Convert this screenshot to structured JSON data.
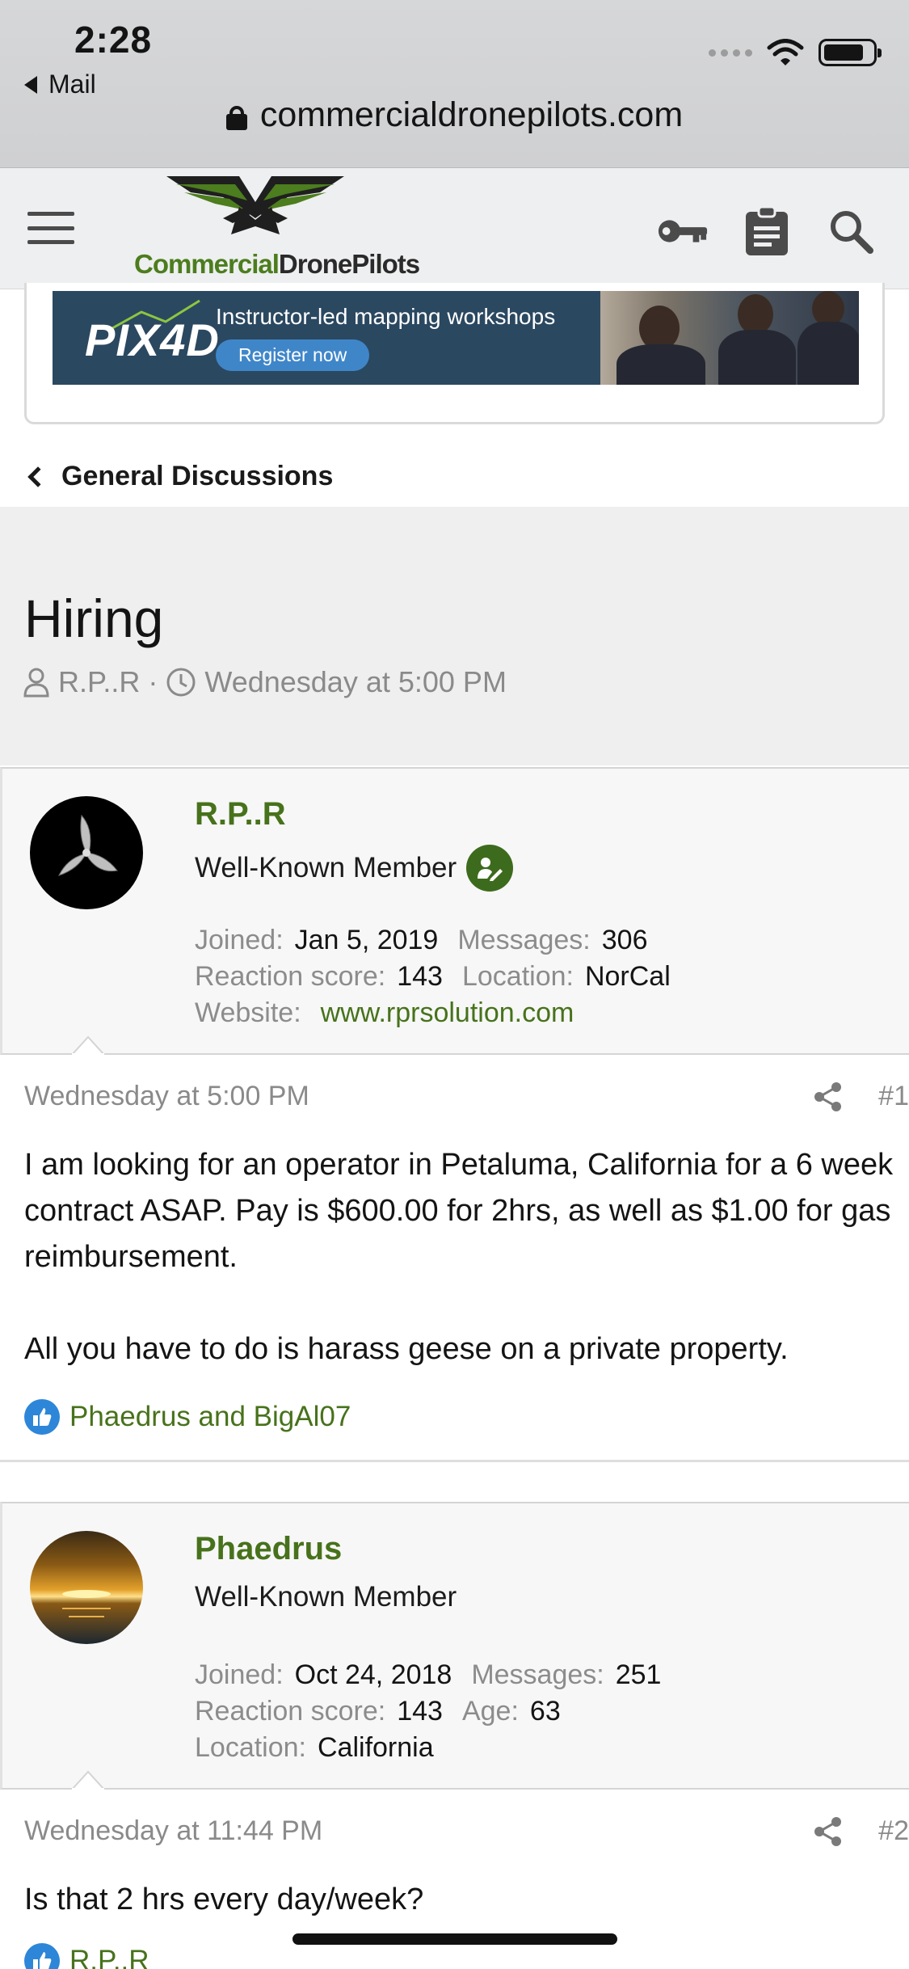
{
  "status_bar": {
    "time": "2:28",
    "back_app": "Mail"
  },
  "browser": {
    "url": "commercialdronepilots.com"
  },
  "site": {
    "logo_commercial": "Commercial",
    "logo_drone_pilots": "DronePilots",
    "brand_green": "#47721b"
  },
  "ad": {
    "logo": "PIX4D",
    "title": "Instructor-led mapping workshops",
    "button": "Register now"
  },
  "breadcrumb": {
    "label": "General Discussions"
  },
  "thread": {
    "title": "Hiring",
    "author": "R.P..R",
    "separator": "·",
    "date": "Wednesday at 5:00 PM"
  },
  "posts": [
    {
      "username": "R.P..R",
      "user_title": "Well-Known Member",
      "stats": {
        "joined_label": "Joined:",
        "joined": "Jan 5, 2019",
        "messages_label": "Messages:",
        "messages": "306",
        "reaction_label": "Reaction score:",
        "reaction": "143",
        "location_label": "Location:",
        "location": "NorCal",
        "website_label": "Website:",
        "website": "www.rprsolution.com"
      },
      "date": "Wednesday at 5:00 PM",
      "number": "#1",
      "paragraph1": "I am looking for an operator in Petaluma, California for a 6 week contract ASAP. Pay is $600.00 for 2hrs, as well as $1.00 for gas reimbursement.",
      "paragraph2": "All you have to do is harass geese on a private property.",
      "reactions": "Phaedrus and BigAl07"
    },
    {
      "username": "Phaedrus",
      "user_title": "Well-Known Member",
      "stats": {
        "joined_label": "Joined:",
        "joined": "Oct 24, 2018",
        "messages_label": "Messages:",
        "messages": "251",
        "reaction_label": "Reaction score:",
        "reaction": "143",
        "age_label": "Age:",
        "age": "63",
        "location_label": "Location:",
        "location": "California"
      },
      "date": "Wednesday at 11:44 PM",
      "number": "#2",
      "paragraph1": "Is that 2 hrs every day/week?",
      "reactions": "R.P..R"
    }
  ]
}
